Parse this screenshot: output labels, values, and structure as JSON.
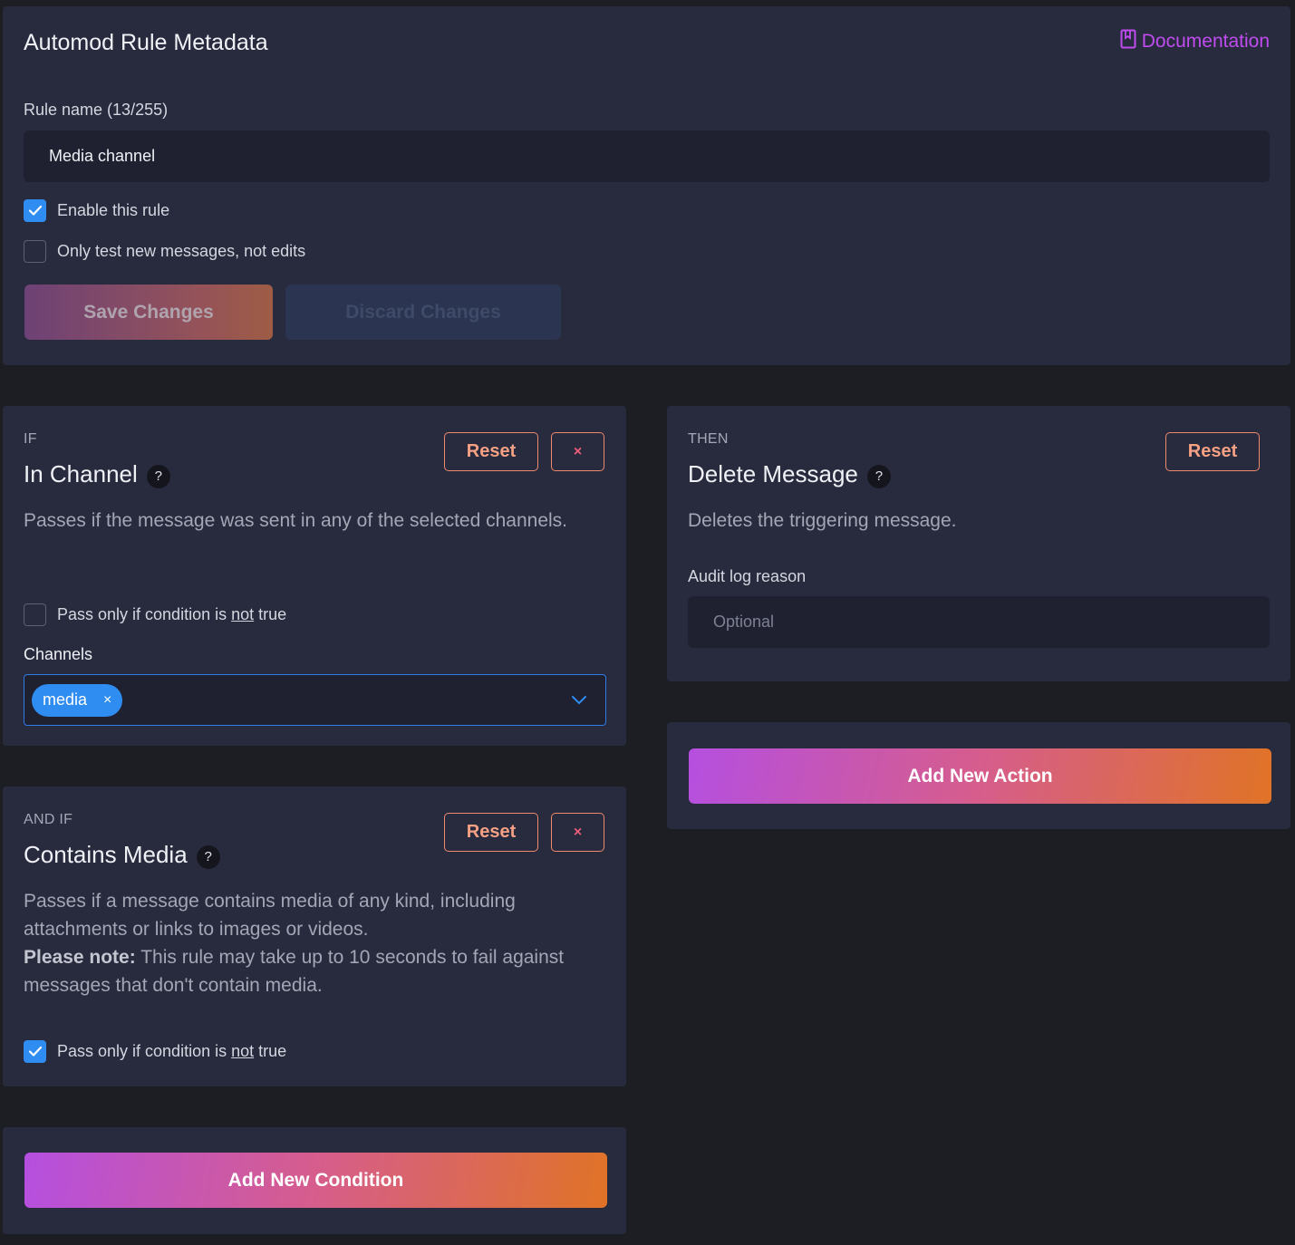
{
  "metadata": {
    "title": "Automod Rule Metadata",
    "documentation_link": "Documentation",
    "rule_name_label": "Rule name (13/255)",
    "rule_name_value": "Media channel",
    "enable_rule_label": "Enable this rule",
    "enable_rule_checked": true,
    "only_new_label": "Only test new messages, not edits",
    "only_new_checked": false,
    "save_button": "Save Changes",
    "discard_button": "Discard Changes"
  },
  "conditions": [
    {
      "kicker": "IF",
      "title": "In Channel",
      "help": "?",
      "reset_button": "Reset",
      "remove_button": "×",
      "description": "Passes if the message was sent in any of the selected channels.",
      "invert_label_prefix": "Pass only if condition is",
      "invert_label_not": "not",
      "invert_label_suffix": "true",
      "invert_checked": false,
      "channels_label": "Channels",
      "channels": [
        {
          "label": "media",
          "remove": "×"
        }
      ]
    },
    {
      "kicker": "AND IF",
      "title": "Contains Media",
      "help": "?",
      "reset_button": "Reset",
      "remove_button": "×",
      "description": "Passes if a message contains media of any kind, including attachments or links to images or videos.",
      "note_label": "Please note:",
      "note_text": "This rule may take up to 10 seconds to fail against messages that don't contain media.",
      "invert_label_prefix": "Pass only if condition is",
      "invert_label_not": "not",
      "invert_label_suffix": "true",
      "invert_checked": true
    }
  ],
  "add_condition_button": "Add New Condition",
  "actions": [
    {
      "kicker": "THEN",
      "title": "Delete Message",
      "help": "?",
      "reset_button": "Reset",
      "description": "Deletes the triggering message.",
      "audit_label": "Audit log reason",
      "audit_placeholder": "Optional"
    }
  ],
  "add_action_button": "Add New Action",
  "colors": {
    "background": "#1d1e24",
    "panel": "#282b3d",
    "accent_blue": "#2f8cf0",
    "documentation_purple": "#c04cf0",
    "reset_orange": "#f08a6c"
  },
  "icons": {
    "documentation": "book-icon",
    "checkbox_checked": "checkmark-icon",
    "select_arrow": "chevron-down-icon",
    "chip_remove": "close-icon"
  }
}
